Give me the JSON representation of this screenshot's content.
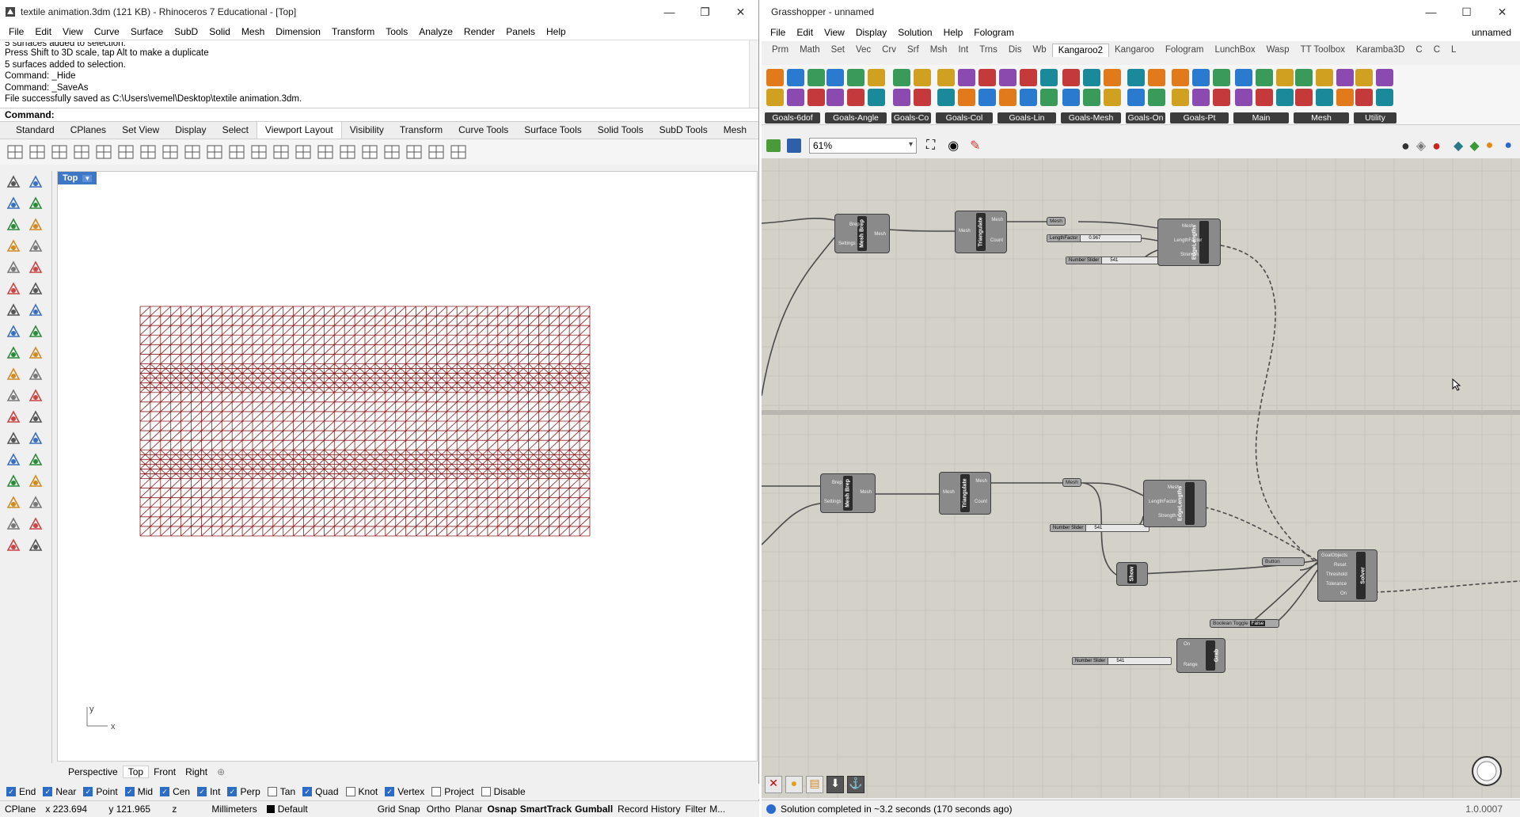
{
  "rhino": {
    "title": "textile animation.3dm (121 KB) - Rhinoceros 7 Educational - [Top]",
    "menu": [
      "File",
      "Edit",
      "View",
      "Curve",
      "Surface",
      "SubD",
      "Solid",
      "Mesh",
      "Dimension",
      "Transform",
      "Tools",
      "Analyze",
      "Render",
      "Panels",
      "Help"
    ],
    "history": [
      "5 surfaces added to selection.",
      "Press Shift to 3D scale, tap Alt to make a duplicate",
      "5 surfaces added to selection.",
      "Command: _Hide",
      "Command: _SaveAs",
      "File successfully saved as C:\\Users\\vemel\\Desktop\\textile animation.3dm."
    ],
    "command_prompt": "Command:",
    "tabs": [
      "Standard",
      "CPlanes",
      "Set View",
      "Display",
      "Select",
      "Viewport Layout",
      "Visibility",
      "Transform",
      "Curve Tools",
      "Surface Tools",
      "Solid Tools",
      "SubD Tools",
      "Mesh"
    ],
    "active_tab": "Viewport Layout",
    "viewport_label": "Top",
    "axis_y": "y",
    "axis_x": "x",
    "viewport_tabs": [
      "Perspective",
      "Top",
      "Front",
      "Right"
    ],
    "active_viewport_tab": "Top",
    "osnaps": [
      {
        "label": "End",
        "checked": true
      },
      {
        "label": "Near",
        "checked": true
      },
      {
        "label": "Point",
        "checked": true
      },
      {
        "label": "Mid",
        "checked": true
      },
      {
        "label": "Cen",
        "checked": true
      },
      {
        "label": "Int",
        "checked": true
      },
      {
        "label": "Perp",
        "checked": true
      },
      {
        "label": "Tan",
        "checked": false
      },
      {
        "label": "Quad",
        "checked": true
      },
      {
        "label": "Knot",
        "checked": false
      },
      {
        "label": "Vertex",
        "checked": true
      },
      {
        "label": "Project",
        "checked": false
      },
      {
        "label": "Disable",
        "checked": false
      }
    ],
    "status": {
      "cplane": "CPlane",
      "x": "x 223.694",
      "y": "y 121.965",
      "z": "z",
      "units": "Millimeters",
      "layer": "Default",
      "grid_snap": "Grid Snap",
      "ortho": "Ortho",
      "planar": "Planar",
      "osnap": "Osnap",
      "smarttrack": "SmartTrack",
      "gumball": "Gumball",
      "record_history": "Record History",
      "filter": "Filter",
      "more": "M..."
    },
    "mesh_color": "#8b1a1a"
  },
  "gh": {
    "title": "Grasshopper - unnamed",
    "menu": [
      "File",
      "Edit",
      "View",
      "Display",
      "Solution",
      "Help",
      "Fologram"
    ],
    "doc_name": "unnamed",
    "tabs": [
      "Prm",
      "Math",
      "Set",
      "Vec",
      "Crv",
      "Srf",
      "Msh",
      "Int",
      "Trns",
      "Dis",
      "Wb",
      "Kangaroo2",
      "Kangaroo",
      "Fologram",
      "LunchBox",
      "Wasp",
      "TT Toolbox",
      "Karamba3D",
      "C",
      "C",
      "L"
    ],
    "active_tab": "Kangaroo2",
    "groups": [
      "Goals-6dof",
      "Goals-Angle",
      "Goals-Co",
      "Goals-Col",
      "Goals-Lin",
      "Goals-Mesh",
      "Goals-On",
      "Goals-Pt",
      "Main",
      "Mesh",
      "Utility"
    ],
    "zoom": "61%",
    "status": "Solution completed in ~3.2 seconds (170 seconds ago)",
    "version": "1.0.0007",
    "canvas_color": "#d3d1c8",
    "nodes": {
      "mesh_brep": "Mesh Brep",
      "triangulate": "Triangulate",
      "edge_lengths": "EdgeLengths",
      "show": "Show",
      "grab": "Grab",
      "solver": "Solver",
      "mesh_param": "Mesh",
      "length_factor": "LengthFactor",
      "length_factor_value": "0.967",
      "number_slider": "Number Slider",
      "slider_value": "541",
      "button": "Button",
      "boolean_toggle": "Boolean Toggle",
      "toggle_value": "False",
      "in_brep": "Brep",
      "in_settings": "Settings",
      "out_mesh": "Mesh",
      "in_mesh": "Mesh",
      "out_count": "Count",
      "in_length": "LengthFactor",
      "in_strength": "Strength",
      "in_on": "On",
      "in_range": "Range",
      "in_goalobjects": "GoalObjects",
      "in_reset": "Reset",
      "in_threshold": "Threshold",
      "in_tolerance": "Tolerance"
    }
  }
}
